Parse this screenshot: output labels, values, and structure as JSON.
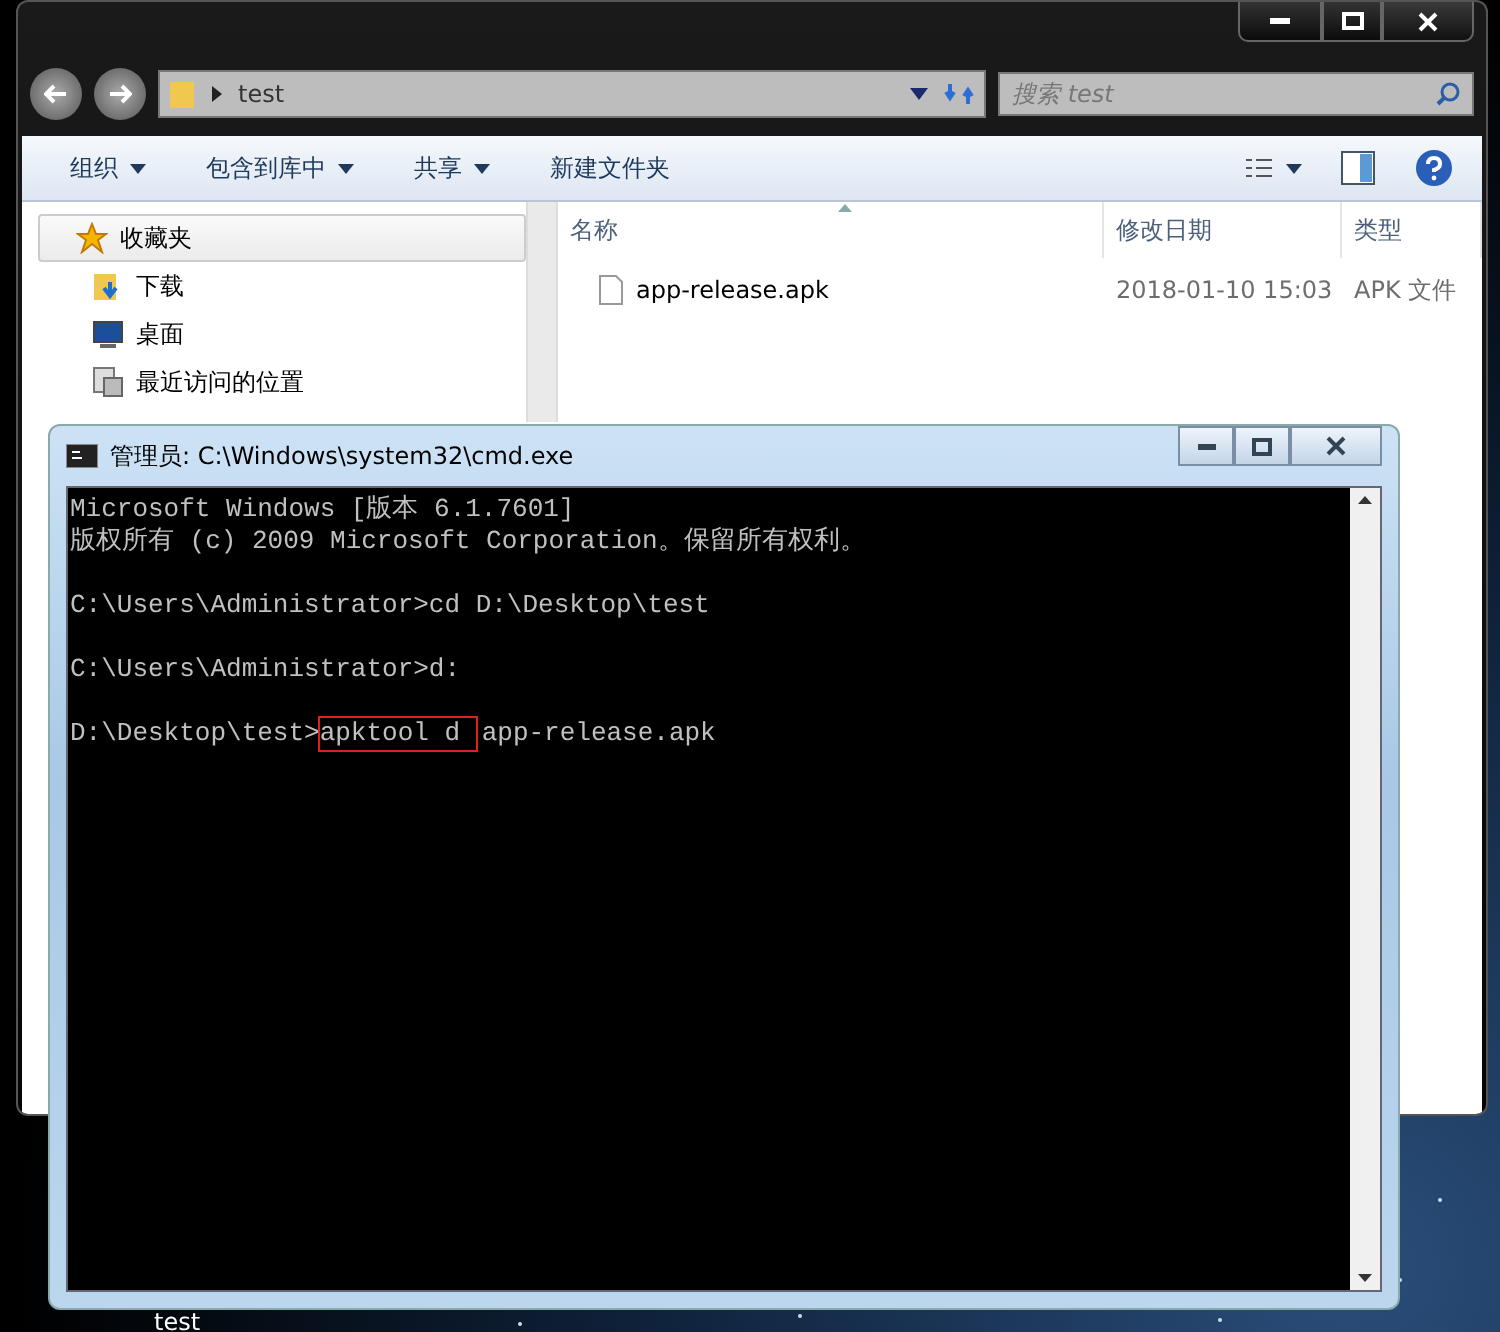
{
  "explorer": {
    "address": "test",
    "search": {
      "placeholder": "搜索 test"
    },
    "toolbar": [
      {
        "label": "组织",
        "dropdown": true
      },
      {
        "label": "包含到库中",
        "dropdown": true
      },
      {
        "label": "共享",
        "dropdown": true
      },
      {
        "label": "新建文件夹",
        "dropdown": false
      }
    ],
    "nav": [
      {
        "label": "收藏夹",
        "selected": true,
        "children": [
          {
            "label": "下载",
            "selected": false
          },
          {
            "label": "桌面",
            "selected": false
          },
          {
            "label": "最近访问的位置",
            "selected": false
          }
        ]
      }
    ],
    "columns": [
      "名称",
      "修改日期",
      "类型"
    ],
    "files": [
      {
        "name": "app-release.apk",
        "modified": "2018-01-10 15:03",
        "type": "APK 文件"
      }
    ]
  },
  "cmd": {
    "title": "管理员: C:\\Windows\\system32\\cmd.exe",
    "blocks": [
      [
        [
          {
            "text": "Microsoft Windows [版本 6.1.7601]",
            "highlighted": false
          }
        ],
        [
          {
            "text": "版权所有 (c) 2009 Microsoft Corporation。保留所有权利。",
            "highlighted": false
          }
        ]
      ],
      [
        [
          {
            "text": "C:\\Users\\Administrator>cd D:\\Desktop\\test",
            "highlighted": false
          }
        ]
      ],
      [
        [
          {
            "text": "C:\\Users\\Administrator>d:",
            "highlighted": false
          }
        ]
      ],
      [
        [
          {
            "text": "D:\\Desktop\\test>",
            "highlighted": false
          },
          {
            "text": "apktool d ",
            "highlighted": true
          },
          {
            "text": "app-release.apk",
            "highlighted": false
          }
        ]
      ]
    ]
  },
  "desktop_icon": {
    "label": "test"
  }
}
